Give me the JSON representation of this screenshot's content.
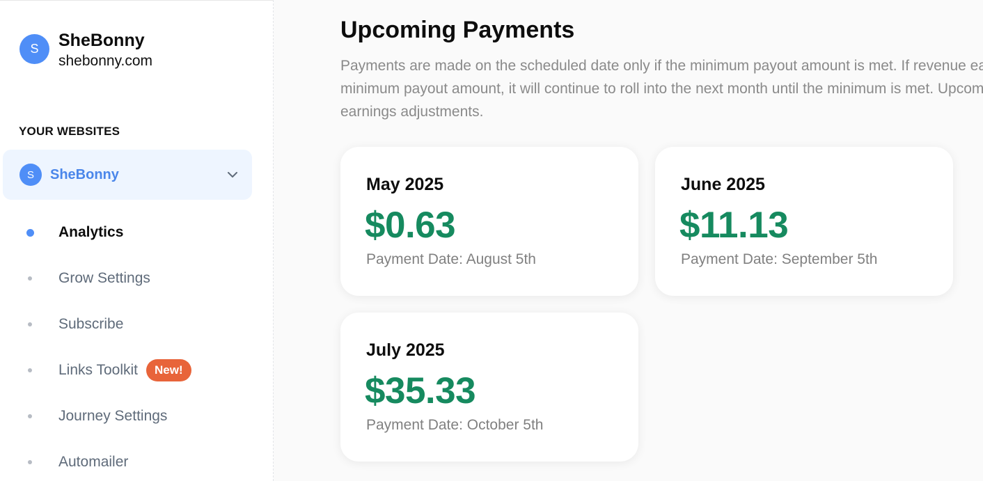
{
  "account": {
    "avatar_letter": "S",
    "name": "SheBonny",
    "domain": "shebonny.com"
  },
  "sidebar": {
    "section_title": "YOUR WEBSITES",
    "site": {
      "avatar_letter": "S",
      "name": "SheBonny",
      "expanded": true
    },
    "items": [
      {
        "label": "Analytics",
        "active": true
      },
      {
        "label": "Grow Settings"
      },
      {
        "label": "Subscribe"
      },
      {
        "label": "Links Toolkit",
        "badge": "New!"
      },
      {
        "label": "Journey Settings"
      },
      {
        "label": "Automailer"
      }
    ]
  },
  "main": {
    "title": "Upcoming Payments",
    "description": "Payments are made on the scheduled date only if the minimum payout amount is met. If revenue earne minimum payout amount, it will continue to roll into the next month until the minimum is met. Upcomi earnings adjustments.",
    "payments": [
      {
        "month": "May 2025",
        "amount": "$0.63",
        "date": "Payment Date: August 5th"
      },
      {
        "month": "June 2025",
        "amount": "$11.13",
        "date": "Payment Date: September 5th"
      },
      {
        "month": "July 2025",
        "amount": "$35.33",
        "date": "Payment Date: October 5th"
      }
    ]
  },
  "colors": {
    "accent": "#4f8ef7",
    "amount_green": "#168a5f",
    "badge_orange": "#e8643a",
    "selected_bg": "#eef5ff"
  },
  "icons": {
    "site_dropdown": "chevron-down-icon"
  }
}
